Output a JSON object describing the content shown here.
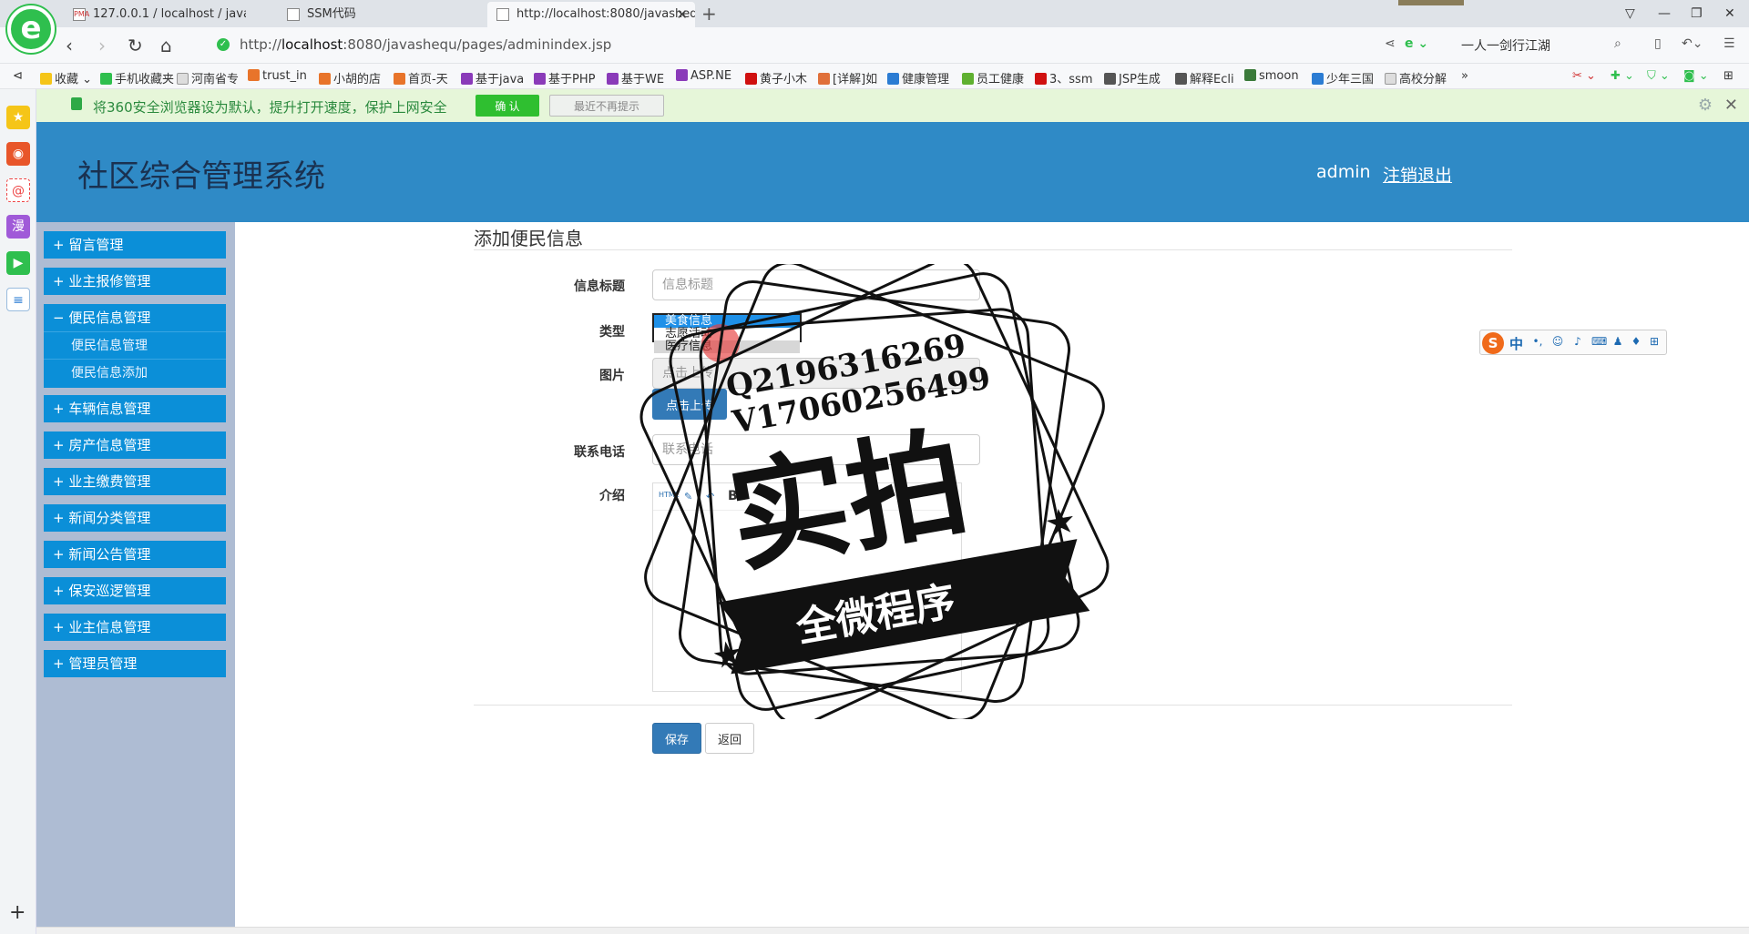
{
  "browser": {
    "tabs": [
      {
        "label": "127.0.0.1 / localhost / javashe",
        "icon": "phpmyadmin-icon"
      },
      {
        "label": "SSM代码",
        "icon": "document-icon"
      },
      {
        "label": "http://localhost:8080/javasheq",
        "icon": "page-icon"
      }
    ],
    "url_prefix": "http://",
    "url_host": "localhost",
    "url_rest": ":8080/javashequ/pages/adminindex.jsp",
    "search_text": "一人一剑行江湖",
    "bookmarks": [
      "收藏",
      "手机收藏夹",
      "河南省专",
      "trust_in",
      "小胡的店",
      "首页-天",
      "基于java",
      "基于PHP",
      "基于WE",
      "ASP.NE",
      "黄子小木",
      "[详解]如",
      "健康管理",
      "员工健康",
      "3、ssm",
      "JSP生成",
      "解释Ecli",
      "smoon",
      "少年三国",
      "高校分解",
      "»"
    ],
    "notice": {
      "text": "将360安全浏览器设为默认，提升打开速度，保护上网安全",
      "ok": "确 认",
      "later": "最近不再提示"
    },
    "logo_letter": "e"
  },
  "app": {
    "title": "社区综合管理系统",
    "user": "admin",
    "logout": "注销退出",
    "menu": [
      {
        "label": "+ 留言管理"
      },
      {
        "label": "+ 业主报修管理"
      },
      {
        "label": "− 便民信息管理",
        "children": [
          "便民信息管理",
          "便民信息添加"
        ]
      },
      {
        "label": "+ 车辆信息管理"
      },
      {
        "label": "+ 房产信息管理"
      },
      {
        "label": "+ 业主缴费管理"
      },
      {
        "label": "+ 新闻分类管理"
      },
      {
        "label": "+ 新闻公告管理"
      },
      {
        "label": "+ 保安巡逻管理"
      },
      {
        "label": "+ 业主信息管理"
      },
      {
        "label": "+ 管理员管理"
      }
    ],
    "form": {
      "heading": "添加便民信息",
      "title_label": "信息标题",
      "title_placeholder": "信息标题",
      "type_label": "类型",
      "type_options": [
        "美食信息",
        "志愿活动",
        "医疗信息"
      ],
      "type_selected": "美食信息",
      "image_label": "图片",
      "image_placeholder": "点击上传",
      "upload_button": "点击上传",
      "phone_label": "联系电话",
      "phone_placeholder": "联系电话",
      "intro_label": "介绍",
      "editor_toolbar": [
        "HTML",
        "B"
      ],
      "save": "保存",
      "back": "返回"
    }
  },
  "watermark": {
    "line1": "Q2196316269",
    "line2": "V17060256499",
    "big": "实拍",
    "ribbon": "全微程序"
  },
  "ime": {
    "logo": "S",
    "mode": "中"
  }
}
